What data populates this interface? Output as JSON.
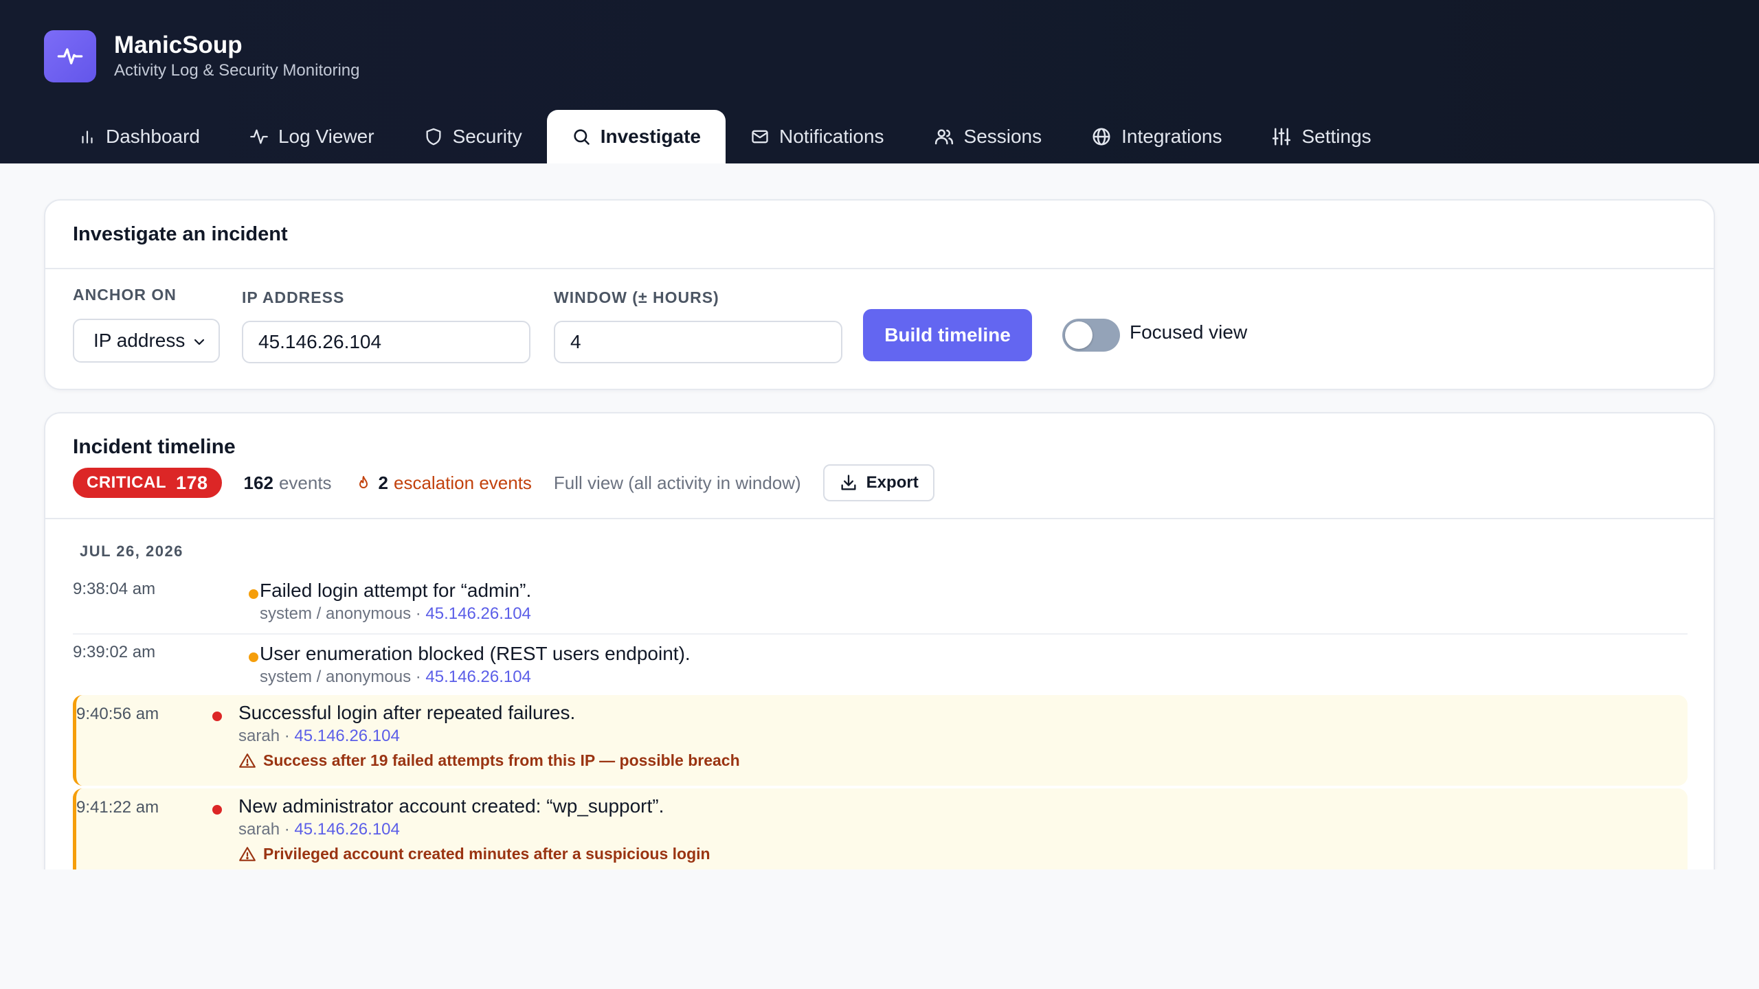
{
  "brand": {
    "title": "ManicSoup",
    "subtitle": "Activity Log & Security Monitoring",
    "logo_icon": "activity-pulse-icon",
    "logo_color": "#6d5ef2"
  },
  "tabs": [
    {
      "label": "Dashboard",
      "icon": "bar-chart-icon",
      "active": false
    },
    {
      "label": "Log Viewer",
      "icon": "activity-icon",
      "active": false
    },
    {
      "label": "Security",
      "icon": "shield-icon",
      "active": false
    },
    {
      "label": "Investigate",
      "icon": "search-icon",
      "active": true
    },
    {
      "label": "Notifications",
      "icon": "mail-icon",
      "active": false
    },
    {
      "label": "Sessions",
      "icon": "users-icon",
      "active": false
    },
    {
      "label": "Integrations",
      "icon": "globe-icon",
      "active": false
    },
    {
      "label": "Settings",
      "icon": "sliders-icon",
      "active": false
    }
  ],
  "investigate": {
    "title": "Investigate an incident",
    "anchor_label": "ANCHOR ON",
    "anchor_value": "IP address",
    "ip_label": "IP ADDRESS",
    "ip_value": "45.146.26.104",
    "window_label": "WINDOW (± HOURS)",
    "window_value": "4",
    "build_button": "Build timeline",
    "focused_label": "Focused view",
    "focused_on": false
  },
  "timeline": {
    "title": "Incident timeline",
    "severity": "CRITICAL",
    "severity_score": "178",
    "event_count": "162",
    "events_word": "events",
    "escalation_count": "2",
    "escalation_word": "escalation events",
    "view_mode": "Full view (all activity in window)",
    "export_label": "Export",
    "date": "JUL 26, 2026",
    "events": [
      {
        "time": "9:38:04 am",
        "message": "Failed login attempt for “admin”.",
        "actor": "system / anonymous",
        "sep": " · ",
        "ip": "45.146.26.104",
        "level": "warning",
        "flag": ""
      },
      {
        "time": "9:39:02 am",
        "message": "User enumeration blocked (REST users endpoint).",
        "actor": "system / anonymous",
        "sep": " · ",
        "ip": "45.146.26.104",
        "level": "warning",
        "flag": ""
      },
      {
        "time": "9:40:56 am",
        "message": "Successful login after repeated failures.",
        "actor": "sarah",
        "sep": " · ",
        "ip": "45.146.26.104",
        "level": "critical",
        "flag": "Success after 19 failed attempts from this IP — possible breach"
      },
      {
        "time": "9:41:22 am",
        "message": "New administrator account created: “wp_support”.",
        "actor": "sarah",
        "sep": " · ",
        "ip": "45.146.26.104",
        "level": "critical",
        "flag": "Privileged account created minutes after a suspicious login"
      }
    ]
  },
  "colors": {
    "accent": "#6366f1",
    "critical": "#dc2626",
    "warning": "#f59e0b",
    "escalation_text": "#c2410c",
    "flag_bg": "#fefbea"
  }
}
